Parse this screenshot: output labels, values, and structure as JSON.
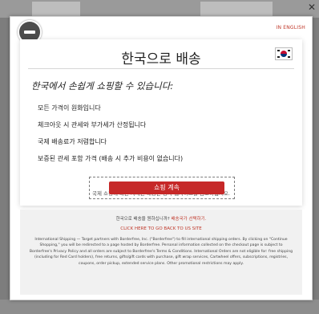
{
  "background": {
    "close_glyph": "✕"
  },
  "modal": {
    "language_link": "IN ENGLISH",
    "title": "한국으로 배송",
    "subtitle": "한국에서 손쉽게 쇼핑할 수 있습니다:",
    "features": [
      "모든 가격이 원화입니다",
      "체크아웃 시 관세와 부가세가 산정됩니다",
      "국제 배송료가 저렴합니다",
      "보증된 관세 포함 가격 (배송 시 추가 비용이 없습니다)"
    ],
    "note": "국제 쇼핑에 대한 자세한 내용은 당사 웹사이트를 참조하십시오.",
    "shop_button": "쇼핑 계속",
    "info_question": "한국으로 배송을 원하십니까?",
    "info_change_link": "배송국가 선택하기.",
    "back_link": "CLICK HERE TO GO BACK TO US SITE",
    "legal_1": "International Shipping — Target partners with Borderfree, Inc. (\"Borderfree\") to fill international shipping orders. By clicking on \"Continue Shopping,\" you will be redirected to a page hosted by Borderfree. Personal information collected on the checkout page is subject to Borderfree's Privacy Policy and all orders are subject to Borderfree's Terms & Conditions.",
    "legal_2": "International Orders are not eligible for: free shipping (including for Red Card holders), free returns, gifts/gift cards with purchase, gift wrap services, Cartwheel offers, subscriptions, registries, coupons, order pickup, extended service plans. Other promotional restrictions may apply."
  },
  "icons": {
    "close": "minus-circle-icon",
    "flag": "korea-flag-icon"
  },
  "colors": {
    "accent": "#c62828",
    "link": "#c0392b",
    "overlay": "#7d7d7d",
    "info_bg": "#f1f1f1"
  }
}
